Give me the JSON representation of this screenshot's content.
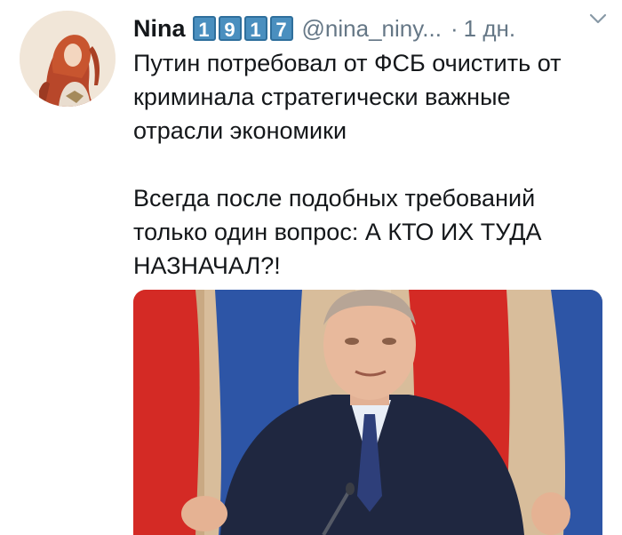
{
  "tweet": {
    "author": {
      "name": "Nina",
      "badges": [
        "1",
        "9",
        "1",
        "7"
      ],
      "handle": "@nina_niny...",
      "separator": "·",
      "time": "1 дн."
    },
    "text": {
      "paragraph1": [
        "Путин потребовал от ФСБ очистить от",
        "криминала стратегически важные",
        "отрасли экономики"
      ],
      "paragraph2": [
        "Всегда после подобных требований",
        "только один вопрос: А КТО ИХ ТУДА",
        "НАЗНАЧАЛ?!"
      ]
    },
    "icons": {
      "menu": "chevron-down-icon",
      "avatar": "avatar-painting",
      "media": "photo-man-in-suit-flags"
    },
    "colors": {
      "badge_blue": "#4a8fbf",
      "muted_text": "#657786",
      "flag_red": "#d42a25",
      "flag_blue": "#2d55a6"
    }
  }
}
